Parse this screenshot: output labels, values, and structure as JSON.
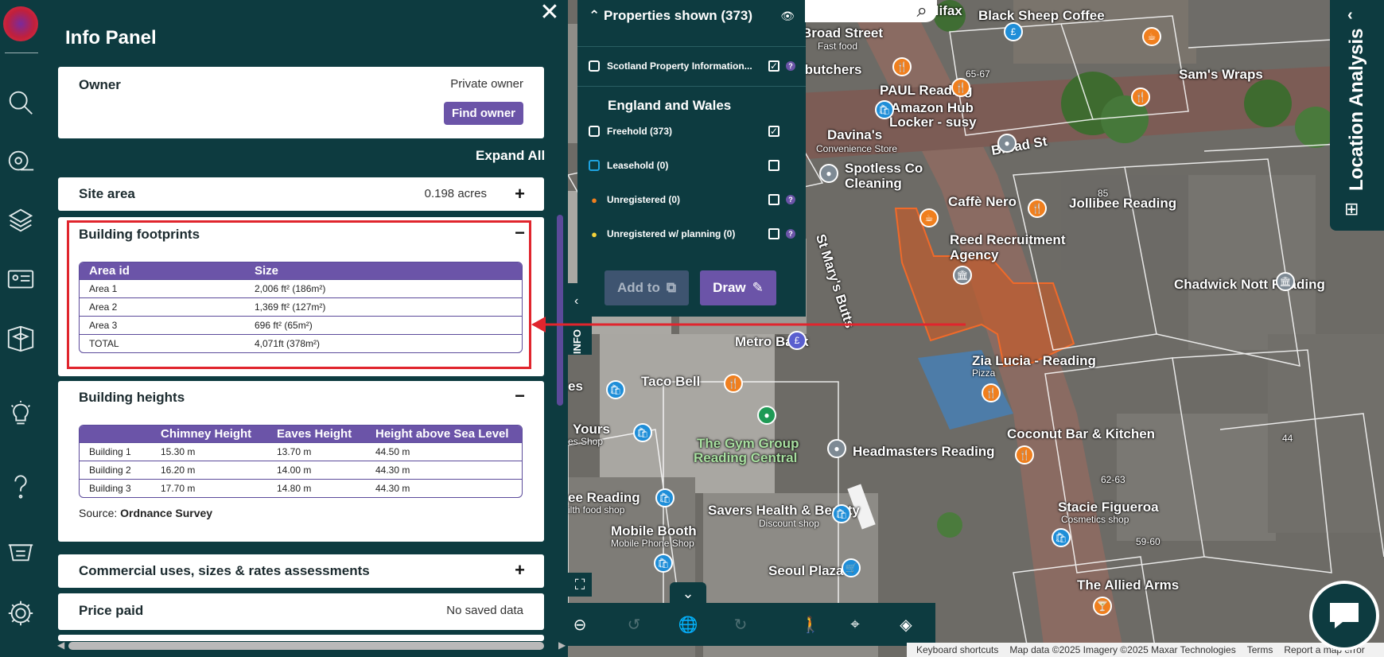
{
  "nav": {
    "items": [
      "search",
      "measure",
      "layers-3d",
      "id-card",
      "book-3d",
      "idea",
      "help",
      "basket",
      "settings"
    ]
  },
  "info_panel": {
    "title": "Info Panel",
    "close_label": "✕",
    "owner": {
      "label": "Owner",
      "value": "Private owner",
      "button": "Find owner"
    },
    "expand_all": "Expand All",
    "site_area": {
      "label": "Site area",
      "value": "0.198 acres",
      "toggle": "+"
    },
    "building_footprints": {
      "label": "Building footprints",
      "toggle": "−",
      "headers": [
        "Area id",
        "Size"
      ],
      "rows": [
        [
          "Area 1",
          "2,006 ft² (186m²)"
        ],
        [
          "Area 2",
          "1,369 ft² (127m²)"
        ],
        [
          "Area 3",
          "696 ft² (65m²)"
        ],
        [
          "TOTAL",
          "4,071ft  (378m²)"
        ]
      ]
    },
    "building_heights": {
      "label": "Building heights",
      "toggle": "−",
      "headers": [
        "",
        "Chimney Height",
        "Eaves Height",
        "Height above Sea Level"
      ],
      "rows": [
        [
          "Building 1",
          "15.30 m",
          "13.70 m",
          "44.50 m"
        ],
        [
          "Building 2",
          "16.20 m",
          "14.00 m",
          "44.30 m"
        ],
        [
          "Building 3",
          "17.70 m",
          "14.80 m",
          "44.30 m"
        ]
      ],
      "source_prefix": "Source: ",
      "source": "Ordnance Survey"
    },
    "commercial": {
      "label": "Commercial uses, sizes & rates assessments",
      "toggle": "+"
    },
    "price_paid": {
      "label": "Price paid",
      "value": "No saved data"
    }
  },
  "layers": {
    "header": "Properties shown (373)",
    "scotland": "Scotland Property Information...",
    "section": "England and Wales",
    "rows": [
      {
        "label": "Freehold (373)",
        "checked": "✓"
      },
      {
        "label": "Leasehold (0)",
        "checked": ""
      },
      {
        "label": "Unregistered (0)",
        "checked": ""
      },
      {
        "label": "Unregistered w/ planning (0)",
        "checked": ""
      }
    ],
    "add_to": "Add to",
    "draw": "Draw",
    "help": "?"
  },
  "info_tab": "INFO",
  "location_tab": "Location Analysis",
  "map": {
    "labels": [
      "Halifax",
      "Black Sheep Coffee",
      "Broad Street",
      "Fast food",
      "Sam's Wraps",
      "ya butchers",
      "PAUL Reading",
      "Amazon Hub",
      "Locker - susy",
      "Davina's",
      "Convenience Store",
      "Broad St",
      "Spotless Co",
      "Cleaning",
      "Caffè Nero",
      "Jollibee Reading",
      "Reed Recruitment",
      "Agency",
      "St Mary's Butts",
      "Chadwick Nott Reading",
      "Metro Bank",
      "Zia Lucia - Reading",
      "Pizza",
      "Taco Bell",
      "Coconut Bar & Kitchen",
      "Yours",
      "es Shop",
      "The Gym Group",
      "Reading Central",
      "Headmasters Reading",
      "ee Reading",
      "ilth food shop",
      "Savers Health & Beauty",
      "Discount shop",
      "Stacie Figueroa",
      "Cosmetics shop",
      "Mobile Booth",
      "Mobile Phone Shop",
      "Seoul Plaza",
      "The Allied Arms",
      "65-67",
      "85",
      "44",
      "62-63",
      "59-60",
      "es"
    ]
  },
  "attribution": {
    "shortcuts": "Keyboard shortcuts",
    "data": "Map data ©2025 Imagery ©2025 Maxar Technologies",
    "terms": "Terms",
    "report": "Report a map error"
  },
  "colors": {
    "panel": "#0d3b40",
    "accent": "#6b54a8",
    "highlight": "#e0252d"
  }
}
